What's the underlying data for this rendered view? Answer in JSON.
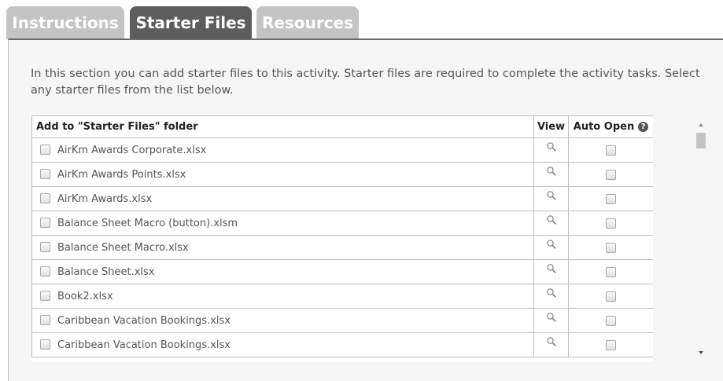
{
  "tabs": {
    "instructions": "Instructions",
    "starter_files": "Starter Files",
    "resources": "Resources",
    "active": "starter_files"
  },
  "intro": "In this section you can add starter files to this activity. Starter files are required to complete the activity tasks. Select any starter files from the list below.",
  "table": {
    "columns": {
      "name": "Add to \"Starter Files\" folder",
      "view": "View",
      "auto_open": "Auto Open"
    },
    "rows": [
      {
        "name": "AirKm Awards Corporate.xlsx",
        "selected": false,
        "auto_open": false
      },
      {
        "name": "AirKm Awards Points.xlsx",
        "selected": false,
        "auto_open": false
      },
      {
        "name": "AirKm Awards.xlsx",
        "selected": false,
        "auto_open": false
      },
      {
        "name": "Balance Sheet Macro (button).xlsm",
        "selected": false,
        "auto_open": false
      },
      {
        "name": "Balance Sheet Macro.xlsx",
        "selected": false,
        "auto_open": false
      },
      {
        "name": "Balance Sheet.xlsx",
        "selected": false,
        "auto_open": false
      },
      {
        "name": "Book2.xlsx",
        "selected": false,
        "auto_open": false
      },
      {
        "name": "Caribbean Vacation Bookings.xlsx",
        "selected": false,
        "auto_open": false
      },
      {
        "name": "Caribbean Vacation Bookings.xlsx",
        "selected": false,
        "auto_open": false
      }
    ]
  },
  "icons": {
    "view": "magnifier-icon",
    "help": "help-icon"
  },
  "colors": {
    "tab_active": "#5d5d5d",
    "tab_inactive": "#c4c4c4",
    "panel_bg": "#f6f6f6"
  }
}
